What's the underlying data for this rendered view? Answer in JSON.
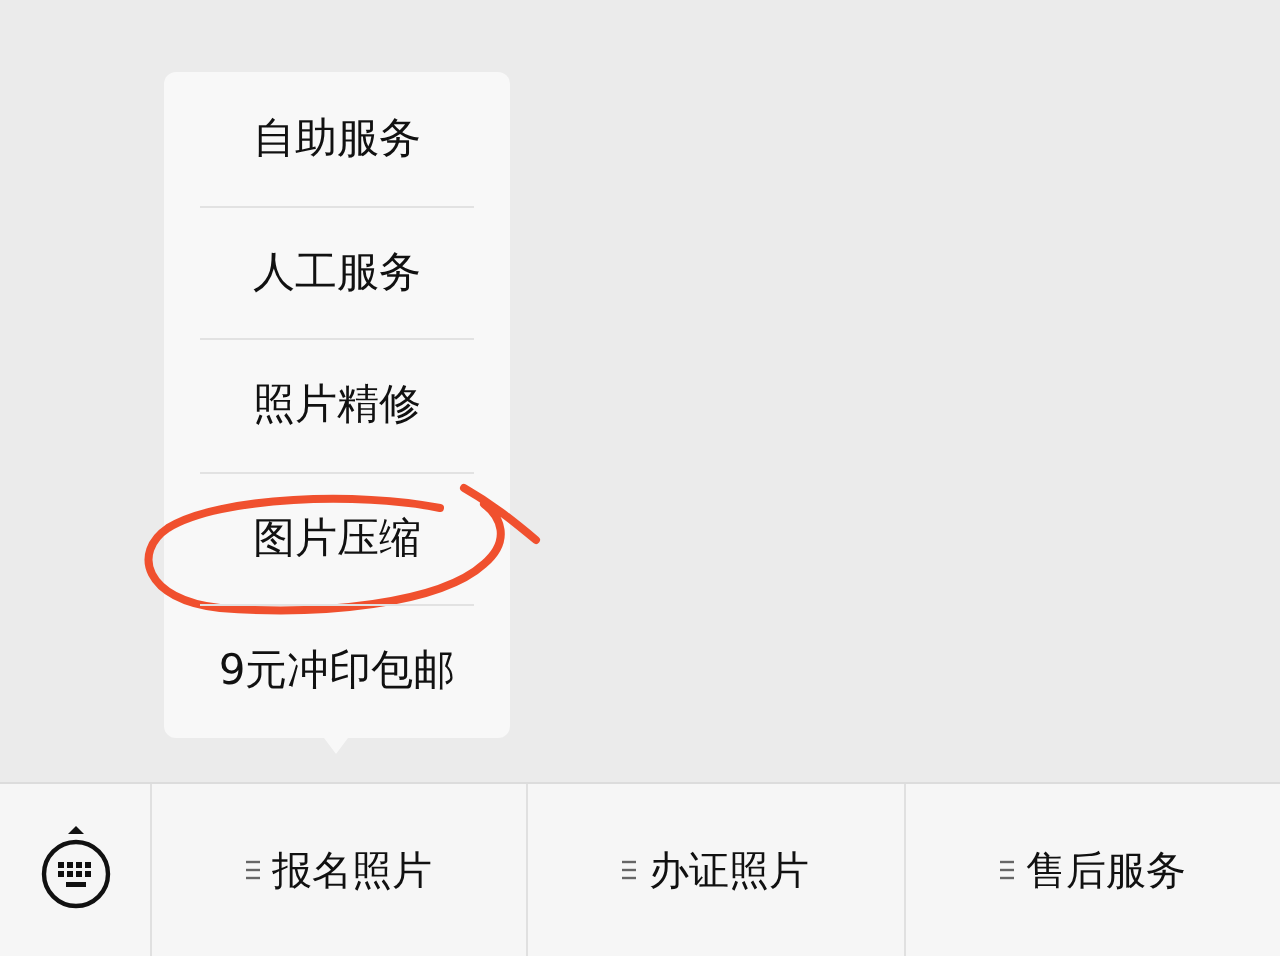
{
  "popup_menu": {
    "items": [
      {
        "label": "自助服务",
        "circled": false
      },
      {
        "label": "人工服务",
        "circled": false
      },
      {
        "label": "照片精修",
        "circled": false
      },
      {
        "label": "图片压缩",
        "circled": true
      },
      {
        "label": "9元冲印包邮",
        "circled": false
      }
    ]
  },
  "bottom_menu": {
    "items": [
      {
        "label": "报名照片"
      },
      {
        "label": "办证照片"
      },
      {
        "label": "售后服务"
      }
    ]
  }
}
